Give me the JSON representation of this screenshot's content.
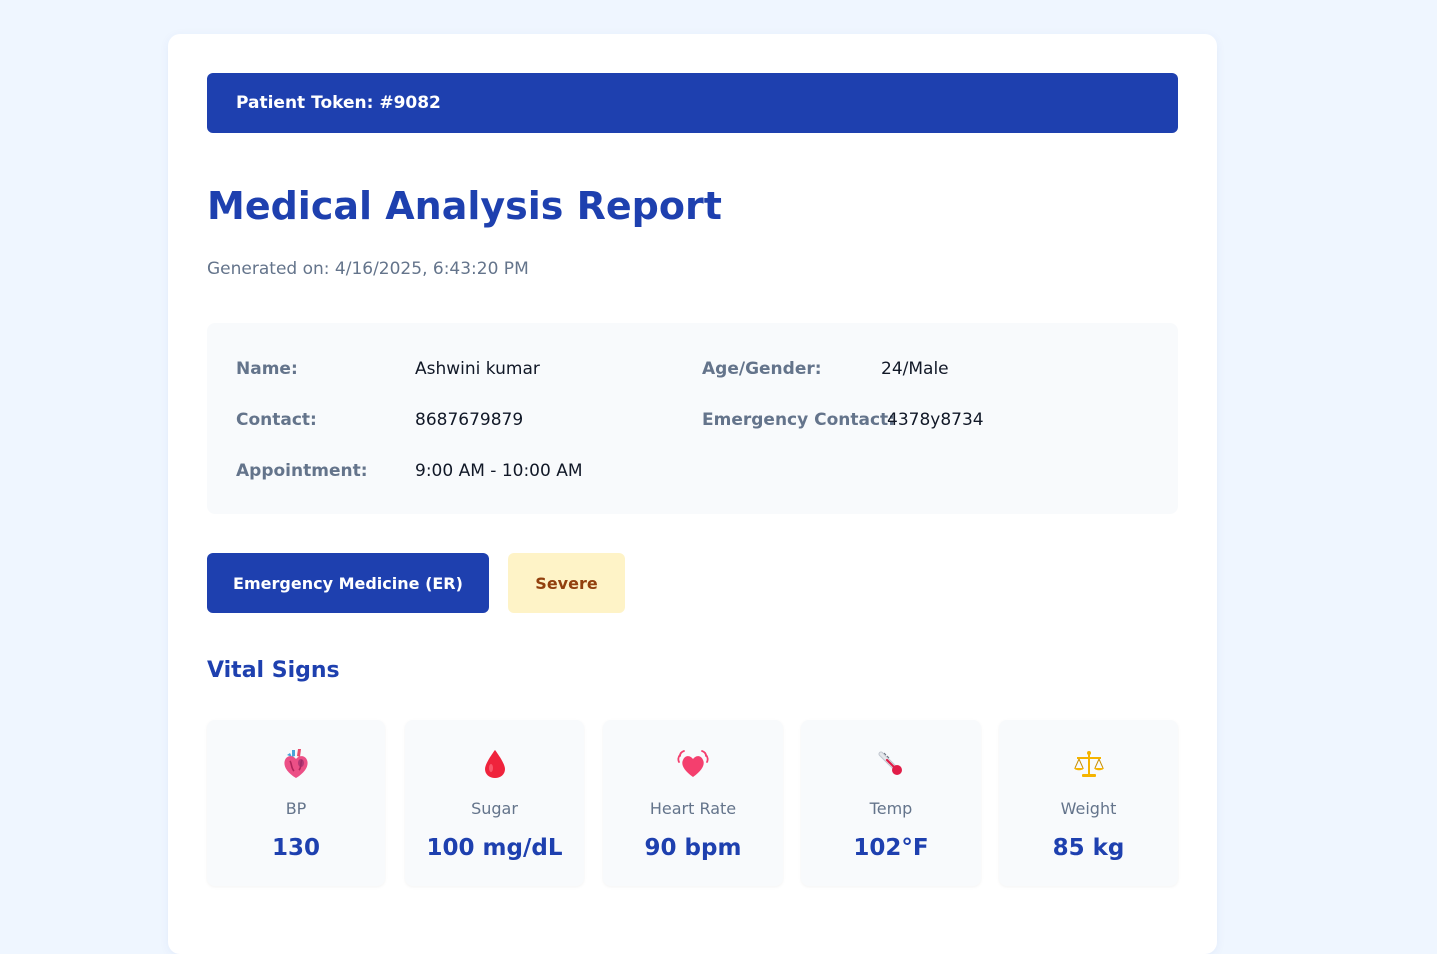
{
  "token": {
    "label": "Patient Token: #9082"
  },
  "report": {
    "title": "Medical Analysis Report",
    "generated": "Generated on: 4/16/2025, 6:43:20 PM"
  },
  "patient": {
    "name_label": "Name:",
    "name": "Ashwini kumar",
    "age_gender_label": "Age/Gender:",
    "age_gender": "24/Male",
    "contact_label": "Contact:",
    "contact": "8687679879",
    "emergency_contact_label": "Emergency Contact:",
    "emergency_contact": "4378y8734",
    "appointment_label": "Appointment:",
    "appointment": "9:00 AM - 10:00 AM"
  },
  "department": {
    "label": "Emergency Medicine (ER)"
  },
  "severity": {
    "label": "Severe",
    "color": "#92400e",
    "background": "#fef3c7"
  },
  "vitals": {
    "heading": "Vital Signs",
    "items": [
      {
        "label": "BP",
        "value": "130",
        "icon": "anatomical-heart-icon"
      },
      {
        "label": "Sugar",
        "value": "100 mg/dL",
        "icon": "blood-drop-icon"
      },
      {
        "label": "Heart Rate",
        "value": "90 bpm",
        "icon": "beating-heart-icon"
      },
      {
        "label": "Temp",
        "value": "102°F",
        "icon": "thermometer-icon"
      },
      {
        "label": "Weight",
        "value": "85 kg",
        "icon": "balance-scale-icon"
      }
    ]
  },
  "colors": {
    "primary": "#1e40af",
    "page_background": "#eff6ff",
    "panel_background": "#f8fafc",
    "muted_text": "#64748b"
  }
}
